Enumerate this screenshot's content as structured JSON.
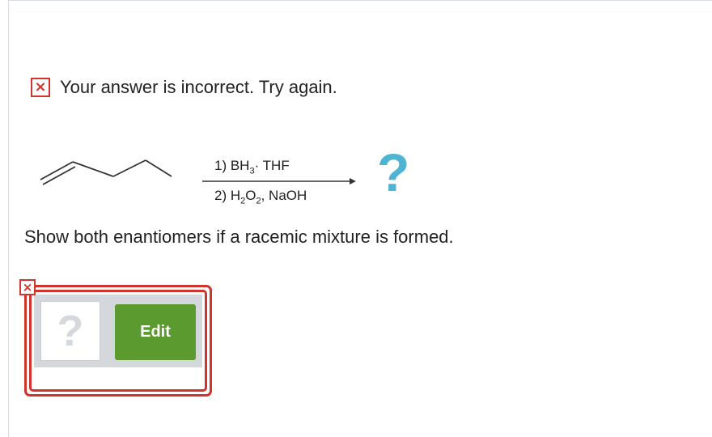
{
  "feedback": {
    "status_icon": "close-icon",
    "status_symbol": "×",
    "message": "Your answer is incorrect.  Try again.",
    "status_color": "#d0342c"
  },
  "reaction": {
    "reagent_line1": {
      "prefix": "1) BH",
      "sub": "3",
      "suffix": "· THF"
    },
    "reagent_line2": {
      "prefix": "2) H",
      "sub1": "2",
      "mid": "O",
      "sub2": "2",
      "suffix": ", NaOH"
    },
    "product_placeholder": "?",
    "product_color": "#4fb3d2"
  },
  "instruction": "Show both enantiomers if a racemic mixture is formed.",
  "answer": {
    "error_symbol": "×",
    "thumbnail_placeholder": "?",
    "edit_label": "Edit",
    "edit_color": "#5a9a2e",
    "error_border_color": "#d0342c"
  }
}
